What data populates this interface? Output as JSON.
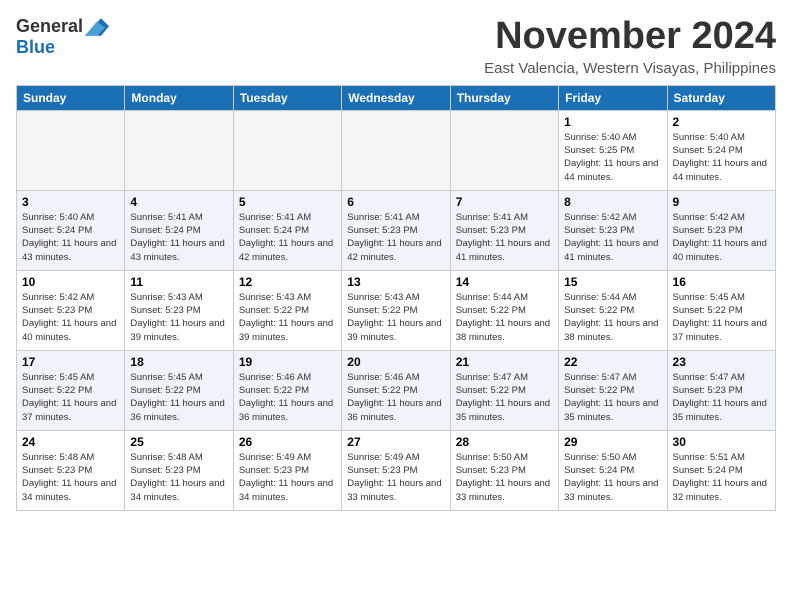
{
  "logo": {
    "general": "General",
    "blue": "Blue"
  },
  "title": {
    "month": "November 2024",
    "location": "East Valencia, Western Visayas, Philippines"
  },
  "weekdays": [
    "Sunday",
    "Monday",
    "Tuesday",
    "Wednesday",
    "Thursday",
    "Friday",
    "Saturday"
  ],
  "weeks": [
    [
      {
        "day": "",
        "empty": true
      },
      {
        "day": "",
        "empty": true
      },
      {
        "day": "",
        "empty": true
      },
      {
        "day": "",
        "empty": true
      },
      {
        "day": "",
        "empty": true
      },
      {
        "day": "1",
        "sunrise": "Sunrise: 5:40 AM",
        "sunset": "Sunset: 5:25 PM",
        "daylight": "Daylight: 11 hours and 44 minutes."
      },
      {
        "day": "2",
        "sunrise": "Sunrise: 5:40 AM",
        "sunset": "Sunset: 5:24 PM",
        "daylight": "Daylight: 11 hours and 44 minutes."
      }
    ],
    [
      {
        "day": "3",
        "sunrise": "Sunrise: 5:40 AM",
        "sunset": "Sunset: 5:24 PM",
        "daylight": "Daylight: 11 hours and 43 minutes."
      },
      {
        "day": "4",
        "sunrise": "Sunrise: 5:41 AM",
        "sunset": "Sunset: 5:24 PM",
        "daylight": "Daylight: 11 hours and 43 minutes."
      },
      {
        "day": "5",
        "sunrise": "Sunrise: 5:41 AM",
        "sunset": "Sunset: 5:24 PM",
        "daylight": "Daylight: 11 hours and 42 minutes."
      },
      {
        "day": "6",
        "sunrise": "Sunrise: 5:41 AM",
        "sunset": "Sunset: 5:23 PM",
        "daylight": "Daylight: 11 hours and 42 minutes."
      },
      {
        "day": "7",
        "sunrise": "Sunrise: 5:41 AM",
        "sunset": "Sunset: 5:23 PM",
        "daylight": "Daylight: 11 hours and 41 minutes."
      },
      {
        "day": "8",
        "sunrise": "Sunrise: 5:42 AM",
        "sunset": "Sunset: 5:23 PM",
        "daylight": "Daylight: 11 hours and 41 minutes."
      },
      {
        "day": "9",
        "sunrise": "Sunrise: 5:42 AM",
        "sunset": "Sunset: 5:23 PM",
        "daylight": "Daylight: 11 hours and 40 minutes."
      }
    ],
    [
      {
        "day": "10",
        "sunrise": "Sunrise: 5:42 AM",
        "sunset": "Sunset: 5:23 PM",
        "daylight": "Daylight: 11 hours and 40 minutes."
      },
      {
        "day": "11",
        "sunrise": "Sunrise: 5:43 AM",
        "sunset": "Sunset: 5:23 PM",
        "daylight": "Daylight: 11 hours and 39 minutes."
      },
      {
        "day": "12",
        "sunrise": "Sunrise: 5:43 AM",
        "sunset": "Sunset: 5:22 PM",
        "daylight": "Daylight: 11 hours and 39 minutes."
      },
      {
        "day": "13",
        "sunrise": "Sunrise: 5:43 AM",
        "sunset": "Sunset: 5:22 PM",
        "daylight": "Daylight: 11 hours and 39 minutes."
      },
      {
        "day": "14",
        "sunrise": "Sunrise: 5:44 AM",
        "sunset": "Sunset: 5:22 PM",
        "daylight": "Daylight: 11 hours and 38 minutes."
      },
      {
        "day": "15",
        "sunrise": "Sunrise: 5:44 AM",
        "sunset": "Sunset: 5:22 PM",
        "daylight": "Daylight: 11 hours and 38 minutes."
      },
      {
        "day": "16",
        "sunrise": "Sunrise: 5:45 AM",
        "sunset": "Sunset: 5:22 PM",
        "daylight": "Daylight: 11 hours and 37 minutes."
      }
    ],
    [
      {
        "day": "17",
        "sunrise": "Sunrise: 5:45 AM",
        "sunset": "Sunset: 5:22 PM",
        "daylight": "Daylight: 11 hours and 37 minutes."
      },
      {
        "day": "18",
        "sunrise": "Sunrise: 5:45 AM",
        "sunset": "Sunset: 5:22 PM",
        "daylight": "Daylight: 11 hours and 36 minutes."
      },
      {
        "day": "19",
        "sunrise": "Sunrise: 5:46 AM",
        "sunset": "Sunset: 5:22 PM",
        "daylight": "Daylight: 11 hours and 36 minutes."
      },
      {
        "day": "20",
        "sunrise": "Sunrise: 5:46 AM",
        "sunset": "Sunset: 5:22 PM",
        "daylight": "Daylight: 11 hours and 36 minutes."
      },
      {
        "day": "21",
        "sunrise": "Sunrise: 5:47 AM",
        "sunset": "Sunset: 5:22 PM",
        "daylight": "Daylight: 11 hours and 35 minutes."
      },
      {
        "day": "22",
        "sunrise": "Sunrise: 5:47 AM",
        "sunset": "Sunset: 5:22 PM",
        "daylight": "Daylight: 11 hours and 35 minutes."
      },
      {
        "day": "23",
        "sunrise": "Sunrise: 5:47 AM",
        "sunset": "Sunset: 5:23 PM",
        "daylight": "Daylight: 11 hours and 35 minutes."
      }
    ],
    [
      {
        "day": "24",
        "sunrise": "Sunrise: 5:48 AM",
        "sunset": "Sunset: 5:23 PM",
        "daylight": "Daylight: 11 hours and 34 minutes."
      },
      {
        "day": "25",
        "sunrise": "Sunrise: 5:48 AM",
        "sunset": "Sunset: 5:23 PM",
        "daylight": "Daylight: 11 hours and 34 minutes."
      },
      {
        "day": "26",
        "sunrise": "Sunrise: 5:49 AM",
        "sunset": "Sunset: 5:23 PM",
        "daylight": "Daylight: 11 hours and 34 minutes."
      },
      {
        "day": "27",
        "sunrise": "Sunrise: 5:49 AM",
        "sunset": "Sunset: 5:23 PM",
        "daylight": "Daylight: 11 hours and 33 minutes."
      },
      {
        "day": "28",
        "sunrise": "Sunrise: 5:50 AM",
        "sunset": "Sunset: 5:23 PM",
        "daylight": "Daylight: 11 hours and 33 minutes."
      },
      {
        "day": "29",
        "sunrise": "Sunrise: 5:50 AM",
        "sunset": "Sunset: 5:24 PM",
        "daylight": "Daylight: 11 hours and 33 minutes."
      },
      {
        "day": "30",
        "sunrise": "Sunrise: 5:51 AM",
        "sunset": "Sunset: 5:24 PM",
        "daylight": "Daylight: 11 hours and 32 minutes."
      }
    ]
  ]
}
